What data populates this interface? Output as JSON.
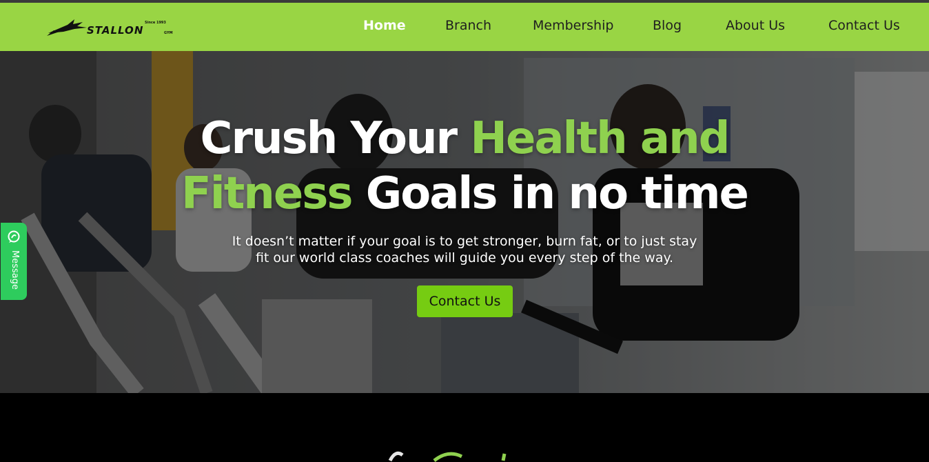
{
  "logo": {
    "name": "STALLON",
    "since": "Since 1993",
    "suffix": "GYM"
  },
  "nav": {
    "items": [
      {
        "label": "Home",
        "active": true
      },
      {
        "label": "Branch",
        "active": false
      },
      {
        "label": "Membership",
        "active": false
      },
      {
        "label": "Blog",
        "active": false
      },
      {
        "label": "About Us",
        "active": false
      },
      {
        "label": "Contact Us",
        "active": false
      }
    ]
  },
  "hero": {
    "headline_part1": "Crush Your ",
    "headline_accent1": "Health and",
    "headline_accent2": "Fitness",
    "headline_part2": " Goals in no time",
    "subtext_line1": "It doesn’t matter if your goal is to get stronger, burn fat, or to just stay",
    "subtext_line2": "fit our world class coaches will guide you every step of the way.",
    "cta_label": "Contact Us"
  },
  "message_tab": {
    "label": "Message",
    "icon": "chat-bubble-icon"
  },
  "colors": {
    "nav_bg": "#99d544",
    "accent_text": "#8fd14f",
    "cta_bg": "#76cc12",
    "message_tab_bg": "#2ecc5d"
  }
}
